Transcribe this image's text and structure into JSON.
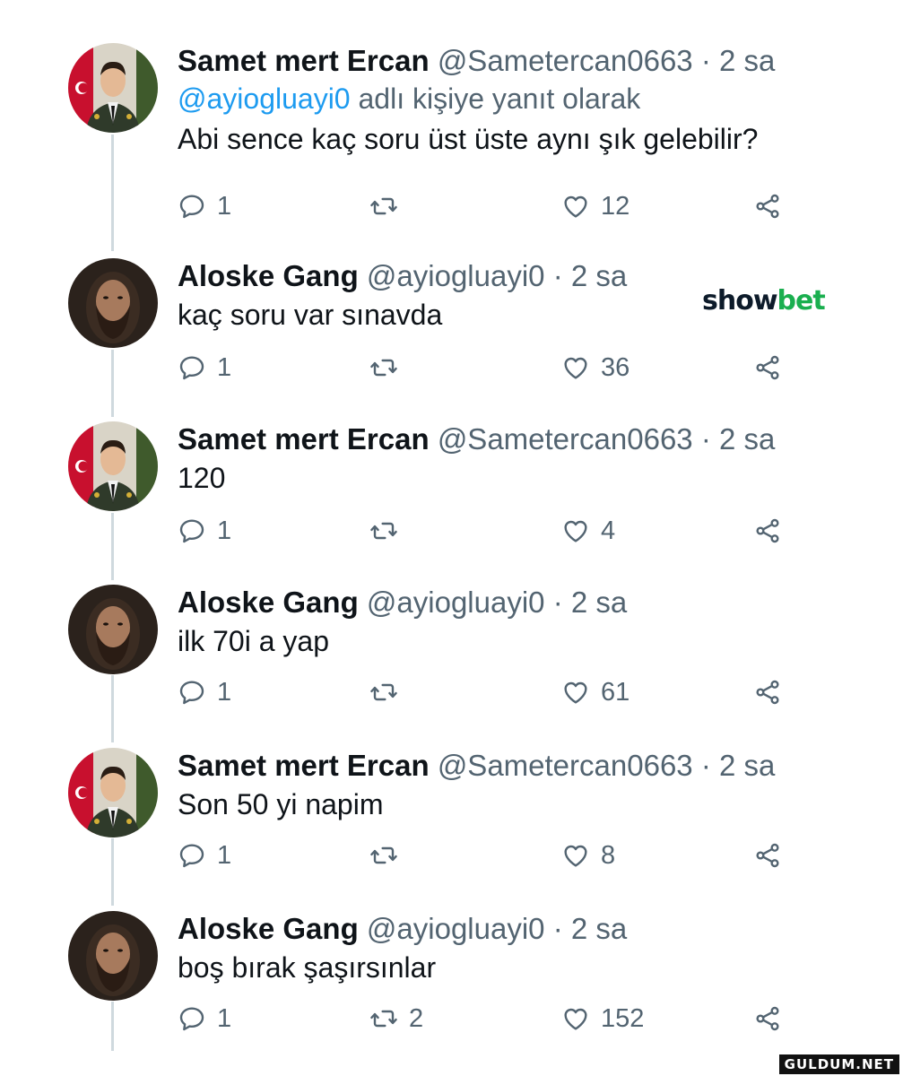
{
  "tweets": [
    {
      "name": "Samet mert Ercan",
      "handle": "@Sametercan0663",
      "sep": "·",
      "time": "2 sa",
      "reply_mention": "@ayiogluayi0",
      "reply_suffix": " adlı kişiye yanıt olarak",
      "text": "Abi sence kaç soru üst üste aynı şık gelebilir?",
      "replies": "1",
      "retweets": "",
      "likes": "12",
      "avatar": "soldier-avatar"
    },
    {
      "name": "Aloske Gang",
      "handle": "@ayiogluayi0",
      "sep": "·",
      "time": "2 sa",
      "text": "kaç soru var sınavda",
      "replies": "1",
      "retweets": "",
      "likes": "36",
      "avatar": "bearded-man-avatar"
    },
    {
      "name": "Samet mert Ercan",
      "handle": "@Sametercan0663",
      "sep": "·",
      "time": "2 sa",
      "text": "120",
      "replies": "1",
      "retweets": "",
      "likes": "4",
      "avatar": "soldier-avatar"
    },
    {
      "name": "Aloske Gang",
      "handle": "@ayiogluayi0",
      "sep": "·",
      "time": "2 sa",
      "text": "ilk 70i a yap",
      "replies": "1",
      "retweets": "",
      "likes": "61",
      "avatar": "bearded-man-avatar"
    },
    {
      "name": "Samet mert Ercan",
      "handle": "@Sametercan0663",
      "sep": "·",
      "time": "2 sa",
      "text": "Son 50 yi napim",
      "replies": "1",
      "retweets": "",
      "likes": "8",
      "avatar": "soldier-avatar"
    },
    {
      "name": "Aloske Gang",
      "handle": "@ayiogluayi0",
      "sep": "·",
      "time": "2 sa",
      "text": "boş bırak şaşırsınlar",
      "replies": "1",
      "retweets": "2",
      "likes": "152",
      "avatar": "bearded-man-avatar"
    }
  ],
  "sponsor": {
    "part1": "show",
    "part2": "bet"
  },
  "watermark": "GULDUM.NET",
  "colors": {
    "text": "#0f1419",
    "secondary": "#536471",
    "mention": "#1d9bf0",
    "thread_line": "#cfd9de",
    "sponsor_dark": "#0d1b2a",
    "sponsor_green": "#1aaf4f"
  },
  "icons": {
    "reply": "reply-bubble-icon",
    "retweet": "retweet-icon",
    "like": "heart-icon",
    "share": "share-icon"
  }
}
